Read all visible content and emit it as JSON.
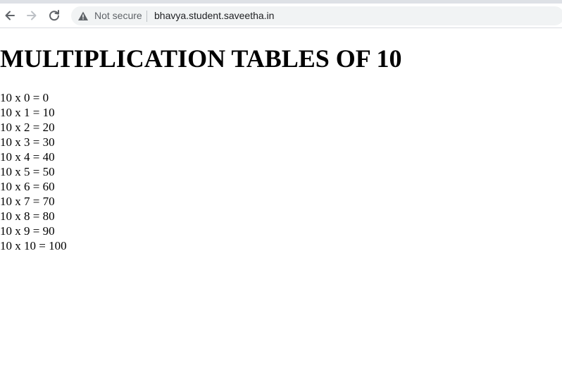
{
  "browser": {
    "security_label": "Not secure",
    "url": "bhavya.student.saveetha.in",
    "icons": {
      "back": "arrow-back-icon",
      "forward": "arrow-forward-icon",
      "reload": "reload-icon",
      "security": "warning-triangle-icon"
    }
  },
  "page": {
    "heading": "MULTIPLICATION TABLES OF 10",
    "lines": [
      "10 x 0 = 0",
      "10 x 1 = 10",
      "10 x 2 = 20",
      "10 x 3 = 30",
      "10 x 4 = 40",
      "10 x 5 = 50",
      "10 x 6 = 60",
      "10 x 7 = 70",
      "10 x 8 = 80",
      "10 x 9 = 90",
      "10 x 10 = 100"
    ]
  }
}
